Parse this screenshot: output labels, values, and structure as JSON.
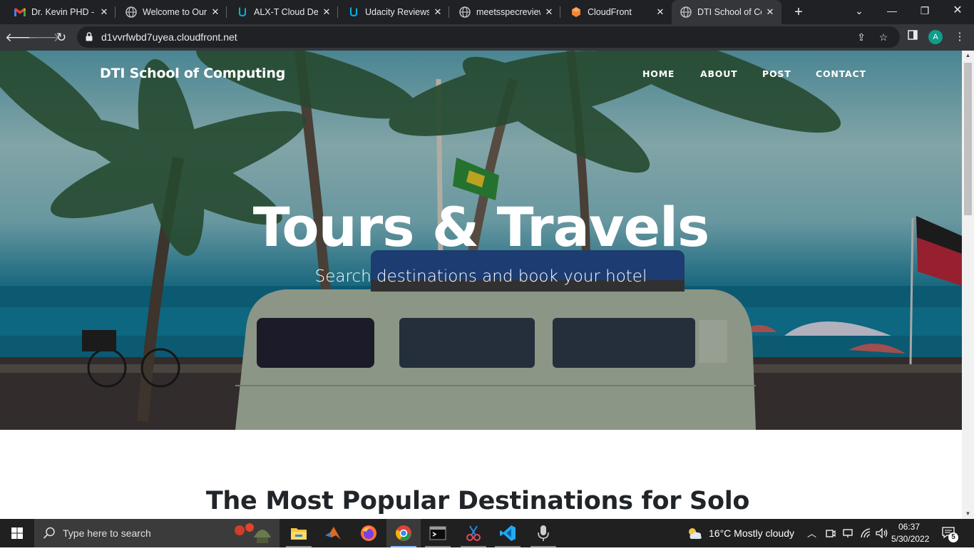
{
  "browser": {
    "tabs": [
      {
        "title": "Dr. Kevin PHD - d",
        "icon": "gmail-icon"
      },
      {
        "title": "Welcome to Our",
        "icon": "globe-icon"
      },
      {
        "title": "ALX-T Cloud Dev",
        "icon": "udacity-icon"
      },
      {
        "title": "Udacity Reviews",
        "icon": "udacity-icon"
      },
      {
        "title": "meetsspecreview",
        "icon": "globe-icon"
      },
      {
        "title": "CloudFront",
        "icon": "aws-icon"
      },
      {
        "title": "DTI School of Co",
        "icon": "globe-icon",
        "active": true
      }
    ],
    "url": "d1vvrfwbd7uyea.cloudfront.net",
    "profile_initial": "A"
  },
  "site": {
    "logo": "DTI School of Computing",
    "nav": [
      "HOME",
      "ABOUT",
      "POST",
      "CONTACT"
    ],
    "hero_title": "Tours & Travels",
    "hero_subtitle": "Search destinations and book your hotel",
    "section_title": "The Most Popular Destinations for Solo"
  },
  "taskbar": {
    "search_placeholder": "Type here to search",
    "weather": "16°C  Mostly cloudy",
    "time": "06:37",
    "date": "5/30/2022",
    "notifications": "5"
  },
  "colors": {
    "browser_frame": "#202124",
    "toolbar": "#35363a",
    "taskbar": "#202020",
    "heading_text": "#212529"
  }
}
